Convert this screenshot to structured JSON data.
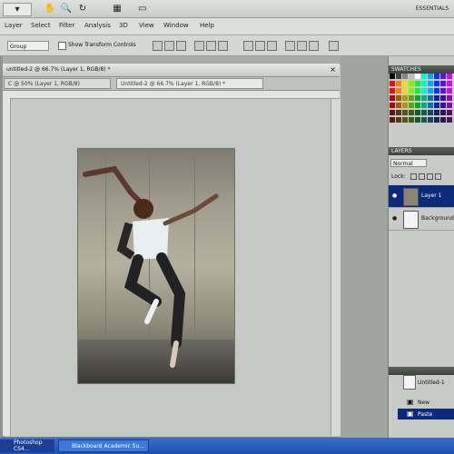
{
  "app": {
    "corner_label": "ESSENTIALS",
    "top_buttons": [
      "h",
      "m",
      "q"
    ]
  },
  "menu": [
    "Layer",
    "Select",
    "Filter",
    "Analysis",
    "3D",
    "View",
    "Window",
    "Help"
  ],
  "options": {
    "auto_select_value": "Group",
    "show_transform_label": "Show Transform Controls"
  },
  "document": {
    "title": "untitled-2 @ 66.7% (Layer 1, RGB/8) *",
    "tabs": [
      "C @ 50% (Layer 1, RGB/8)",
      "Untitled-2 @ 66.7% (Layer 1, RGB/8) *"
    ]
  },
  "panels": {
    "swatches_header": "SWATCHES",
    "layers_header": "LAYERS",
    "blend_mode": "Normal",
    "lock_label": "Lock:",
    "layers": [
      {
        "name": "Layer 1",
        "selected": true
      },
      {
        "name": "Background",
        "selected": false
      }
    ],
    "actions": [
      {
        "name": "Untitled-1"
      },
      {
        "name": "New"
      },
      {
        "name": "Paste",
        "selected": true
      }
    ]
  },
  "taskbar": {
    "items": [
      "Photoshop CS4...",
      "Blackboard Academic Su..."
    ]
  },
  "colors": {
    "taskbar_blue": "#1e4fae",
    "selection_navy": "#0c2a79"
  }
}
